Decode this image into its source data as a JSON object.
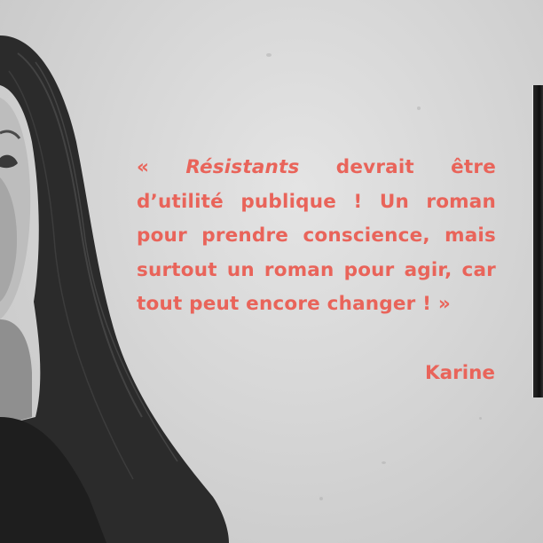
{
  "quote": {
    "open_mark": "« ",
    "book_title": "Résistants",
    "text_after_title": " devrait être d’utilité publique ! Un roman pour prendre conscience, mais surtout un roman pour agir, car tout peut encore changer ! »",
    "author": "Karine"
  },
  "colors": {
    "quote_text": "#e9645a",
    "background": "#d2d2d2",
    "hair": "#2b2b2b"
  },
  "images": {
    "portrait": "portrait-photo",
    "book_cover_edge": "book-cover-edge"
  }
}
